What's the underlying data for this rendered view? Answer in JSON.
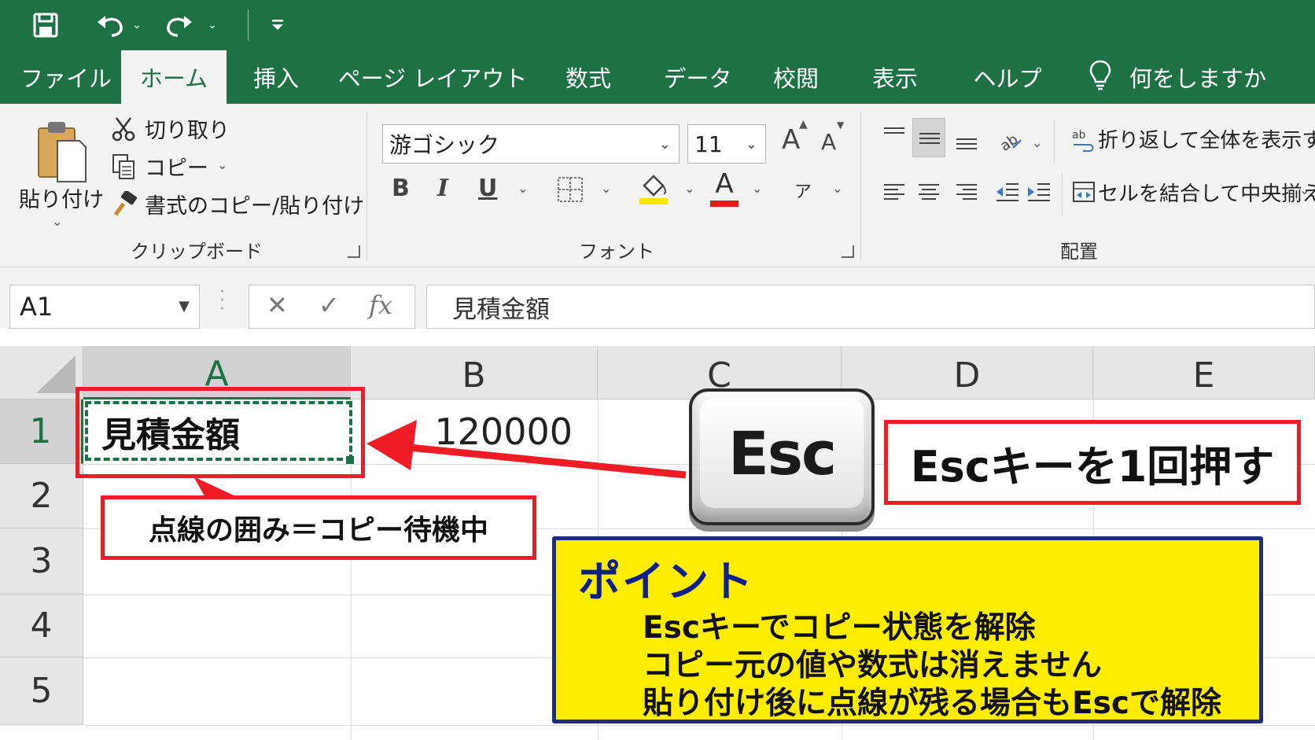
{
  "titlebar": {
    "icons": [
      "save-icon",
      "undo-icon",
      "redo-icon",
      "customize-quick-access-icon"
    ]
  },
  "tabs": [
    {
      "label": "ファイル",
      "active": false
    },
    {
      "label": "ホーム",
      "active": true
    },
    {
      "label": "挿入",
      "active": false
    },
    {
      "label": "ページ レイアウト",
      "active": false
    },
    {
      "label": "数式",
      "active": false
    },
    {
      "label": "データ",
      "active": false
    },
    {
      "label": "校閲",
      "active": false
    },
    {
      "label": "表示",
      "active": false
    },
    {
      "label": "ヘルプ",
      "active": false
    }
  ],
  "search": {
    "label": "何をしますか",
    "icon": "lightbulb-icon"
  },
  "ribbon": {
    "clipboard": {
      "paste_label": "貼り付け",
      "cut_label": "切り取り",
      "copy_label": "コピー",
      "format_painter_label": "書式のコピー/貼り付け",
      "group_label": "クリップボード"
    },
    "font": {
      "font_name": "游ゴシック",
      "font_size": "11",
      "bold": "B",
      "italic": "I",
      "underline": "U",
      "font_color_letter": "A",
      "phonetic_letter": "ア",
      "grow_font": "A",
      "shrink_font": "A",
      "group_label": "フォント",
      "fill_color": "#ffe600",
      "text_color": "#e21b1b"
    },
    "alignment": {
      "wrap_text_label": "折り返して全体を表示する",
      "merge_center_label": "セルを結合して中央揃え",
      "group_label": "配置"
    }
  },
  "formula_bar": {
    "name_box": "A1",
    "cancel": "✕",
    "enter": "✓",
    "fx": "fx",
    "content": "見積金額"
  },
  "sheet": {
    "columns": [
      "A",
      "B",
      "C",
      "D",
      "E"
    ],
    "rows": [
      "1",
      "2",
      "3",
      "4",
      "5"
    ],
    "cells": {
      "A1": "見積金額",
      "B1": "120000"
    },
    "selected_cell": "A1"
  },
  "annotations": {
    "esc_key_label": "Esc",
    "esc_instruction": "Escキーを1回押す",
    "marquee_note": "点線の囲み＝コピー待機中",
    "point": {
      "title": "ポイント",
      "lines": [
        "Escキーでコピー状態を解除",
        "コピー元の値や数式は消えません",
        "貼り付け後に点線が残る場合もEscで解除"
      ]
    },
    "colors": {
      "red": "#ee1c24",
      "marquee": "#1e7145",
      "point_bg": "#ffed00",
      "point_border": "#1c2f7a"
    }
  }
}
